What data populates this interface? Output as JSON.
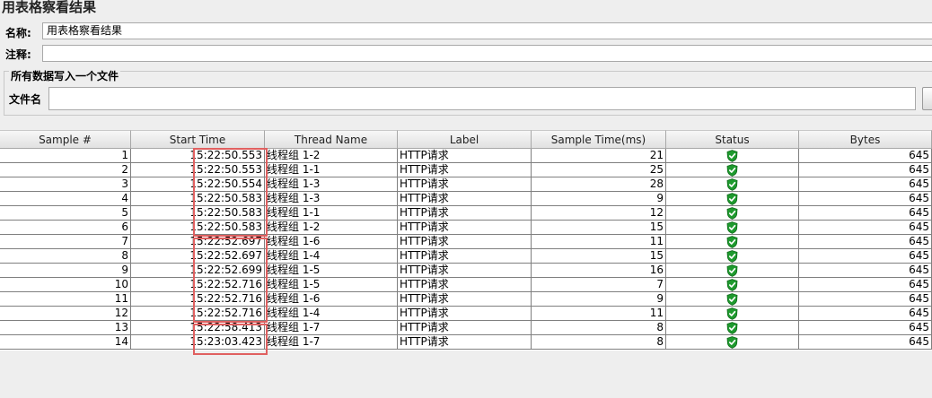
{
  "panel": {
    "title": "用表格察看结果",
    "name_label": "名称:",
    "name_value": "用表格察看结果",
    "comment_label": "注释:",
    "comment_value": "",
    "file_group_legend": "所有数据写入一个文件",
    "file_label": "文件名",
    "file_value": ""
  },
  "table": {
    "columns": [
      "Sample #",
      "Start Time",
      "Thread Name",
      "Label",
      "Sample Time(ms)",
      "Status",
      "Bytes"
    ],
    "rows": [
      {
        "sample": "1",
        "start": "15:22:50.553",
        "thread": "线程组 1-2",
        "label": "HTTP请求",
        "time": "21",
        "status": "success-shield-icon",
        "bytes": "645"
      },
      {
        "sample": "2",
        "start": "15:22:50.553",
        "thread": "线程组 1-1",
        "label": "HTTP请求",
        "time": "25",
        "status": "success-shield-icon",
        "bytes": "645"
      },
      {
        "sample": "3",
        "start": "15:22:50.554",
        "thread": "线程组 1-3",
        "label": "HTTP请求",
        "time": "28",
        "status": "success-shield-icon",
        "bytes": "645"
      },
      {
        "sample": "4",
        "start": "15:22:50.583",
        "thread": "线程组 1-3",
        "label": "HTTP请求",
        "time": "9",
        "status": "success-shield-icon",
        "bytes": "645"
      },
      {
        "sample": "5",
        "start": "15:22:50.583",
        "thread": "线程组 1-1",
        "label": "HTTP请求",
        "time": "12",
        "status": "success-shield-icon",
        "bytes": "645"
      },
      {
        "sample": "6",
        "start": "15:22:50.583",
        "thread": "线程组 1-2",
        "label": "HTTP请求",
        "time": "15",
        "status": "success-shield-icon",
        "bytes": "645"
      },
      {
        "sample": "7",
        "start": "15:22:52.697",
        "thread": "线程组 1-6",
        "label": "HTTP请求",
        "time": "11",
        "status": "success-shield-icon",
        "bytes": "645"
      },
      {
        "sample": "8",
        "start": "15:22:52.697",
        "thread": "线程组 1-4",
        "label": "HTTP请求",
        "time": "15",
        "status": "success-shield-icon",
        "bytes": "645"
      },
      {
        "sample": "9",
        "start": "15:22:52.699",
        "thread": "线程组 1-5",
        "label": "HTTP请求",
        "time": "16",
        "status": "success-shield-icon",
        "bytes": "645"
      },
      {
        "sample": "10",
        "start": "15:22:52.716",
        "thread": "线程组 1-5",
        "label": "HTTP请求",
        "time": "7",
        "status": "success-shield-icon",
        "bytes": "645"
      },
      {
        "sample": "11",
        "start": "15:22:52.716",
        "thread": "线程组 1-6",
        "label": "HTTP请求",
        "time": "9",
        "status": "success-shield-icon",
        "bytes": "645"
      },
      {
        "sample": "12",
        "start": "15:22:52.716",
        "thread": "线程组 1-4",
        "label": "HTTP请求",
        "time": "11",
        "status": "success-shield-icon",
        "bytes": "645"
      },
      {
        "sample": "13",
        "start": "15:22:58.413",
        "thread": "线程组 1-7",
        "label": "HTTP请求",
        "time": "8",
        "status": "success-shield-icon",
        "bytes": "645"
      },
      {
        "sample": "14",
        "start": "15:23:03.423",
        "thread": "线程组 1-7",
        "label": "HTTP请求",
        "time": "8",
        "status": "success-shield-icon",
        "bytes": "645"
      }
    ]
  },
  "colors": {
    "highlight": "#e06060",
    "status_green": "#1e9a2e"
  }
}
